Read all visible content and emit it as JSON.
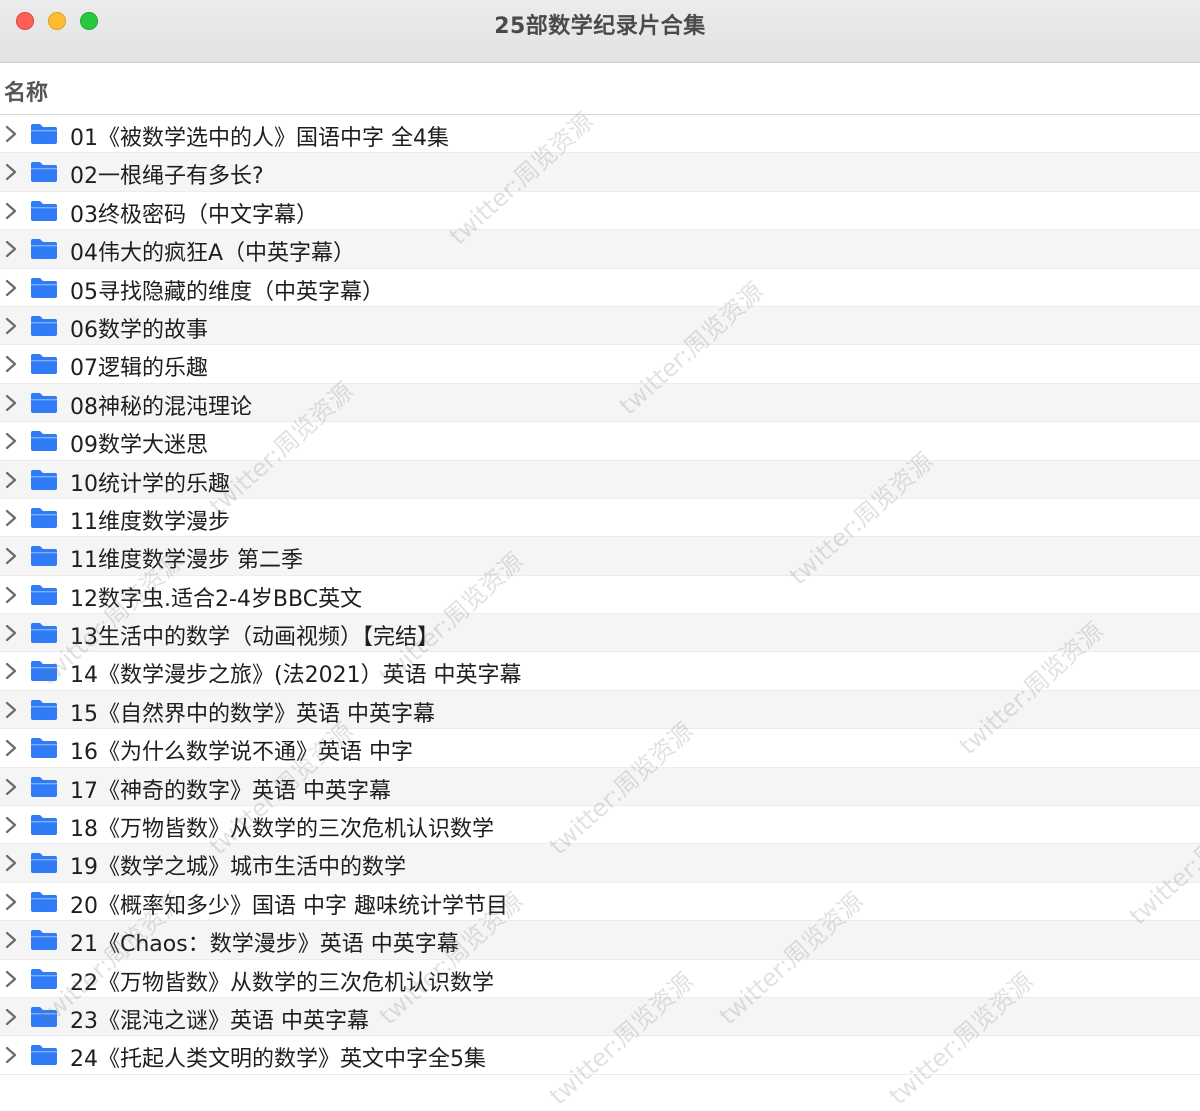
{
  "window": {
    "title": "25部数学纪录片合集"
  },
  "columns": {
    "name_header": "名称"
  },
  "folder_color": "#2f7cf6",
  "items": [
    {
      "label": "01《被数学选中的人》国语中字 全4集"
    },
    {
      "label": "02一根绳子有多长?"
    },
    {
      "label": "03终极密码（中文字幕）"
    },
    {
      "label": "04伟大的疯狂A（中英字幕）"
    },
    {
      "label": "05寻找隐藏的维度（中英字幕）"
    },
    {
      "label": "06数学的故事"
    },
    {
      "label": "07逻辑的乐趣"
    },
    {
      "label": "08神秘的混沌理论"
    },
    {
      "label": "09数学大迷思"
    },
    {
      "label": "10统计学的乐趣"
    },
    {
      "label": "11维度数学漫步"
    },
    {
      "label": "11维度数学漫步 第二季"
    },
    {
      "label": "12数字虫.适合2-4岁BBC英文"
    },
    {
      "label": "13生活中的数学（动画视频）【完结】"
    },
    {
      "label": "14《数学漫步之旅》(法2021）英语 中英字幕"
    },
    {
      "label": "15《自然界中的数学》英语 中英字幕"
    },
    {
      "label": "16《为什么数学说不通》英语 中字"
    },
    {
      "label": "17《神奇的数字》英语 中英字幕"
    },
    {
      "label": "18《万物皆数》从数学的三次危机认识数学"
    },
    {
      "label": "19《数学之城》城市生活中的数学"
    },
    {
      "label": "20《概率知多少》国语 中字 趣味统计学节目"
    },
    {
      "label": "21《Chaos：数学漫步》英语 中英字幕"
    },
    {
      "label": "22《万物皆数》从数学的三次危机认识数学"
    },
    {
      "label": "23《混沌之谜》英语 中英字幕"
    },
    {
      "label": "24《托起人类文明的数学》英文中字全5集"
    }
  ],
  "watermark_text": "twitter:周览资源"
}
